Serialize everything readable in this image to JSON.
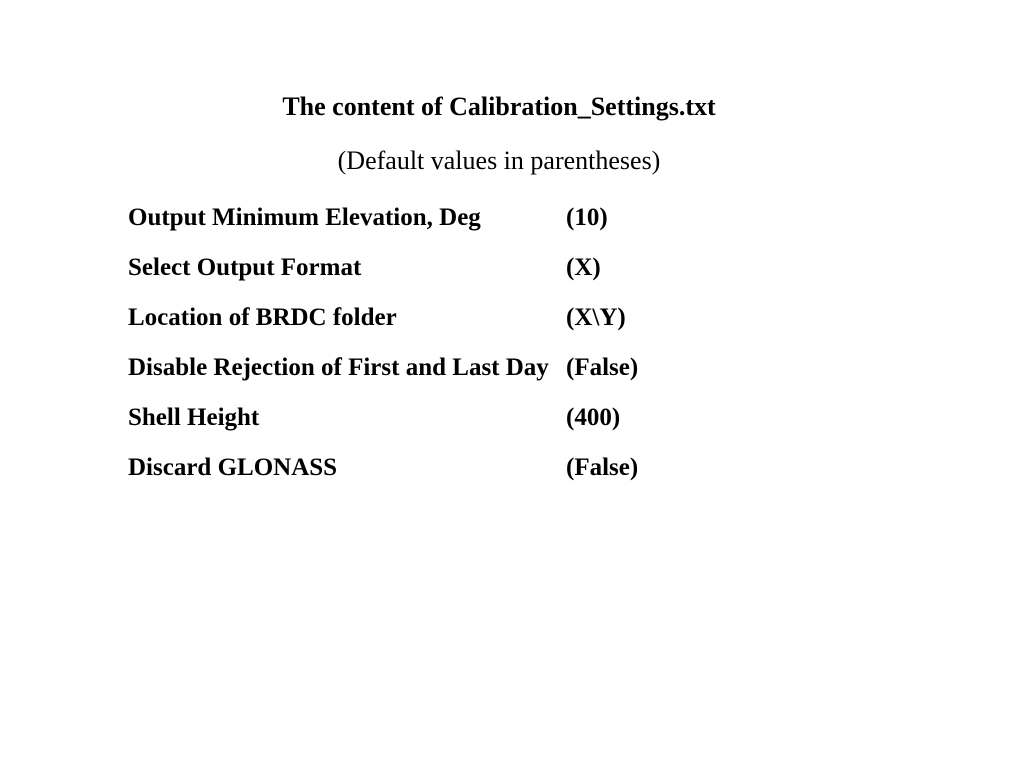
{
  "title": "The content of  Calibration_Settings.txt",
  "subtitle": "(Default values in parentheses)",
  "settings": [
    {
      "label": "Output Minimum Elevation, Deg",
      "value": "(10)"
    },
    {
      "label": "Select Output Format",
      "value": "(X)"
    },
    {
      "label": "Location of BRDC folder",
      "value": "(X\\Y)"
    },
    {
      "label": "Disable Rejection of First and Last Day",
      "value": "(False)"
    },
    {
      "label": "Shell Height",
      "value": "(400)"
    },
    {
      "label": "Discard GLONASS",
      "value": "(False)"
    }
  ]
}
